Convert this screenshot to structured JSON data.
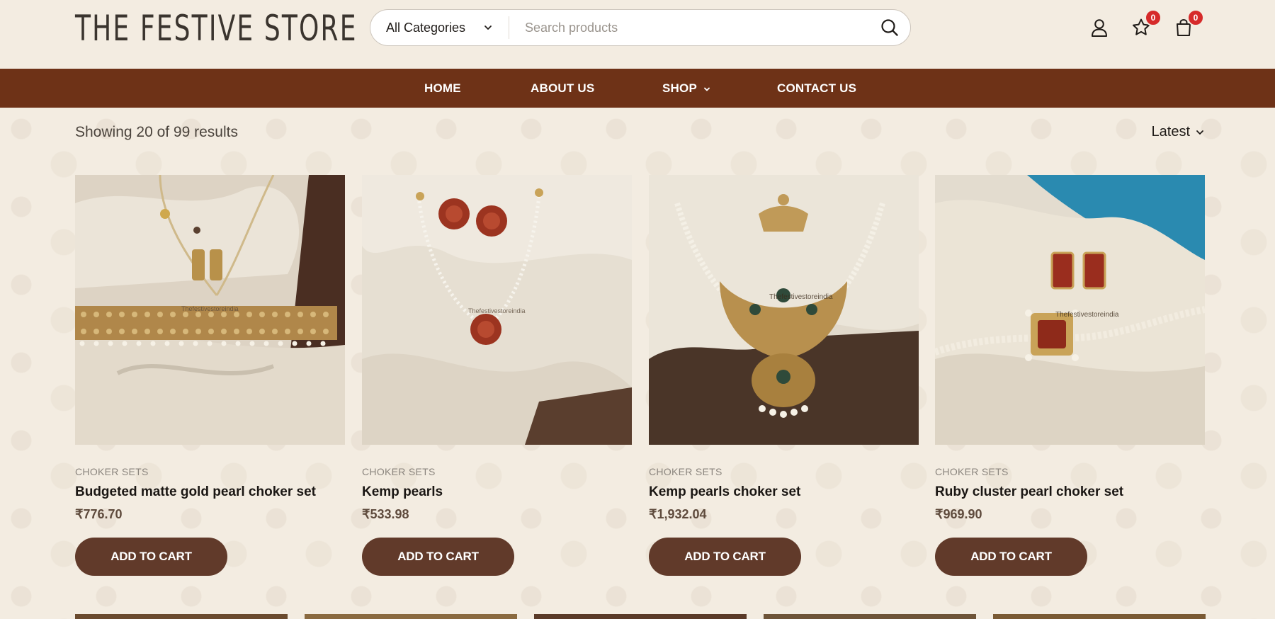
{
  "brand": {
    "logo_text": "THE FESTIVE STORE"
  },
  "search": {
    "category_label": "All Categories",
    "placeholder": "Search products"
  },
  "header": {
    "wishlist_count": "0",
    "cart_count": "0"
  },
  "nav": {
    "items": [
      "HOME",
      "ABOUT US",
      "SHOP",
      "CONTACT US"
    ]
  },
  "toolbar": {
    "results_text": "Showing 20 of 99 results",
    "sort_label": "Latest"
  },
  "products": [
    {
      "category": "CHOKER SETS",
      "title": "Budgeted matte gold pearl choker set",
      "price": "₹776.70",
      "button": "ADD TO CART"
    },
    {
      "category": "CHOKER SETS",
      "title": "Kemp pearls",
      "price": "₹533.98",
      "button": "ADD TO CART"
    },
    {
      "category": "CHOKER SETS",
      "title": "Kemp pearls choker set",
      "price": "₹1,932.04",
      "button": "ADD TO CART"
    },
    {
      "category": "CHOKER SETS",
      "title": "Ruby cluster pearl choker set",
      "price": "₹969.90",
      "button": "ADD TO CART"
    }
  ],
  "watermarks": [
    "Thefestivestoreindia",
    "Thefestivestoreindia",
    "Thefestivestoreindia",
    "Thefestivestoreindia"
  ],
  "colors": {
    "nav_bg": "#6e3217",
    "button_bg": "#613a2a",
    "badge": "#d62a2a",
    "page_bg": "#f3ece1"
  }
}
